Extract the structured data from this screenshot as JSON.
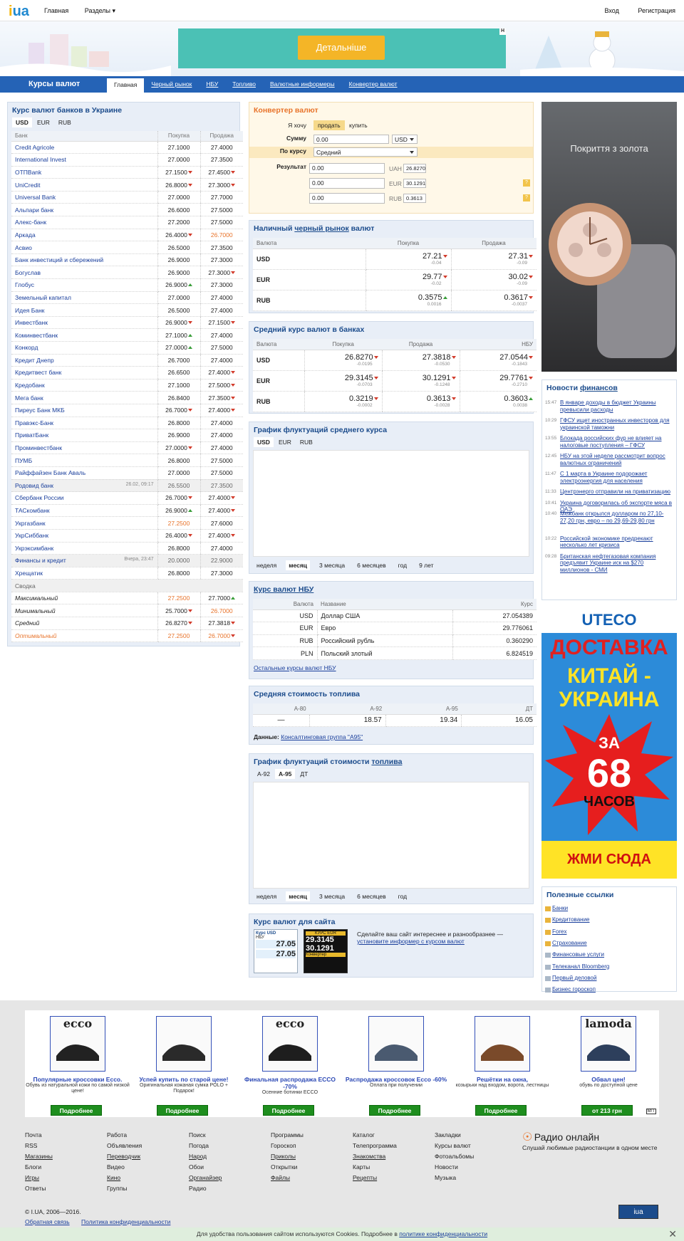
{
  "topbar": {
    "logo_i": "i",
    "logo_ua": "ua",
    "home": "Главная",
    "sections": "Разделы ▾",
    "login": "Вход",
    "register": "Регистрация"
  },
  "banner": {
    "ad_button": "Детальніше",
    "ad_mark": "Н"
  },
  "nav": {
    "title": "Курсы валют",
    "tabs": [
      "Главная",
      "Черный рынок",
      "НБУ",
      "Топливо",
      "Валютные информеры",
      "Конвертер валют"
    ]
  },
  "banks": {
    "title": "Курс валют банков в Украине",
    "currencies": [
      "USD",
      "EUR",
      "RUB"
    ],
    "headers": [
      "Банк",
      "Покупка",
      "Продажа"
    ],
    "rows": [
      {
        "name": "Credit Agricole",
        "buy": "27.1000",
        "sell": "27.4000"
      },
      {
        "name": "International Invest",
        "buy": "27.0000",
        "sell": "27.3500"
      },
      {
        "name": "ОТПBank",
        "buy": "27.1500",
        "sell": "27.4500",
        "bt": "dn",
        "st": "dn"
      },
      {
        "name": "UniCredit",
        "buy": "26.8000",
        "sell": "27.3000",
        "bt": "dn",
        "st": "dn"
      },
      {
        "name": "Universal Bank",
        "buy": "27.0000",
        "sell": "27.7000"
      },
      {
        "name": "Альпари банк",
        "buy": "26.6000",
        "sell": "27.5000"
      },
      {
        "name": "Алекс-банк",
        "buy": "27.2000",
        "sell": "27.5000"
      },
      {
        "name": "Аркада",
        "buy": "26.4000",
        "sell": "26.7000",
        "bt": "dn",
        "so": true
      },
      {
        "name": "Асвио",
        "buy": "26.5000",
        "sell": "27.3500"
      },
      {
        "name": "Банк инвестиций и сбережений",
        "buy": "26.9000",
        "sell": "27.3000"
      },
      {
        "name": "Богуслав",
        "buy": "26.9000",
        "sell": "27.3000",
        "st": "dn"
      },
      {
        "name": "Глобус",
        "buy": "26.9000",
        "sell": "27.3000",
        "bt": "up"
      },
      {
        "name": "Земельный капитал",
        "buy": "27.0000",
        "sell": "27.4000"
      },
      {
        "name": "Идея Банк",
        "buy": "26.5000",
        "sell": "27.4000"
      },
      {
        "name": "Инвестбанк",
        "buy": "26.9000",
        "sell": "27.1500",
        "bt": "dn",
        "st": "dn"
      },
      {
        "name": "Коминвестбанк",
        "buy": "27.1000",
        "sell": "27.4000",
        "bt": "up"
      },
      {
        "name": "Конкорд",
        "buy": "27.0000",
        "sell": "27.5000",
        "bt": "up"
      },
      {
        "name": "Кредит Днепр",
        "buy": "26.7000",
        "sell": "27.4000"
      },
      {
        "name": "Кредитвест банк",
        "buy": "26.6500",
        "sell": "27.4000",
        "st": "dn"
      },
      {
        "name": "Кредобанк",
        "buy": "27.1000",
        "sell": "27.5000",
        "st": "dn"
      },
      {
        "name": "Мега банк",
        "buy": "26.8400",
        "sell": "27.3500",
        "st": "dn"
      },
      {
        "name": "Пиреус Банк МКБ",
        "buy": "26.7000",
        "sell": "27.4000",
        "bt": "dn",
        "st": "dn"
      },
      {
        "name": "Правэкс-Банк",
        "buy": "26.8000",
        "sell": "27.4000"
      },
      {
        "name": "ПриватБанк",
        "buy": "26.9000",
        "sell": "27.4000"
      },
      {
        "name": "Проминвестбанк",
        "buy": "27.0000",
        "sell": "27.4000",
        "bt": "dn"
      },
      {
        "name": "ПУМБ",
        "buy": "26.8000",
        "sell": "27.5000"
      },
      {
        "name": "Райффайзен Банк Аваль",
        "buy": "27.0000",
        "sell": "27.5000"
      },
      {
        "name": "Родовид банк",
        "buy": "26.5500",
        "sell": "27.3500",
        "grey": true,
        "date": "26.02, 09:17"
      },
      {
        "name": "Сбербанк России",
        "buy": "26.7000",
        "sell": "27.4000",
        "bt": "dn",
        "st": "dn"
      },
      {
        "name": "ТАСкомбанк",
        "buy": "26.9000",
        "sell": "27.4000",
        "bt": "up",
        "st": "dn"
      },
      {
        "name": "Укргазбанк",
        "buy": "27.2500",
        "sell": "27.6000",
        "bo": true
      },
      {
        "name": "УкрСиббанк",
        "buy": "26.4000",
        "sell": "27.4000",
        "bt": "dn",
        "st": "dn"
      },
      {
        "name": "Укрэксимбанк",
        "buy": "26.8000",
        "sell": "27.4000"
      },
      {
        "name": "Финансы и кредит",
        "buy": "20.0000",
        "sell": "22.9000",
        "grey": true,
        "date": "Вчера, 23:47"
      },
      {
        "name": "Хрещатик",
        "buy": "26.8000",
        "sell": "27.3000"
      }
    ],
    "summary_label": "Сводка",
    "summary": [
      {
        "name": "Максимальный",
        "buy": "27.2500",
        "sell": "27.7000",
        "bo": true,
        "st": "up"
      },
      {
        "name": "Минимальный",
        "buy": "25.7000",
        "sell": "26.7000",
        "bt": "dn",
        "so": true
      },
      {
        "name": "Средний",
        "buy": "26.8270",
        "sell": "27.3818",
        "bt": "dn",
        "st": "dn"
      },
      {
        "name": "Оптимальный",
        "buy": "27.2500",
        "sell": "26.7000",
        "bo": true,
        "so": true,
        "st": "dn",
        "name_org": true
      }
    ]
  },
  "converter": {
    "title": "Конвертер валют",
    "want": "Я хочу",
    "sell": "продать",
    "buy": "купить",
    "sum": "Сумму",
    "sum_value": "0.00",
    "currency": "USD",
    "rate": "По курсу",
    "rate_value": "Средний",
    "result": "Результат",
    "results": [
      {
        "value": "0.00",
        "cur": "UAH",
        "rate": "26.8270"
      },
      {
        "value": "0.00",
        "cur": "EUR",
        "rate": "30.1291"
      },
      {
        "value": "0.00",
        "cur": "RUB",
        "rate": "0.3613"
      }
    ],
    "help": "?"
  },
  "black": {
    "title_a": "Наличный ",
    "title_b": "черный рынок",
    "title_c": " валют",
    "headers": [
      "Валюта",
      "Покупка",
      "Продажа"
    ],
    "rows": [
      {
        "cur": "USD",
        "buy": "27.21",
        "bd": "-0.04",
        "bt": "dn",
        "sell": "27.31",
        "sd": "-0.09",
        "st": "dn"
      },
      {
        "cur": "EUR",
        "buy": "29.77",
        "bd": "-0.02",
        "bt": "dn",
        "sell": "30.02",
        "sd": "-0.09",
        "st": "dn"
      },
      {
        "cur": "RUB",
        "buy": "0.3575",
        "bd": "0.0016",
        "bt": "up",
        "sell": "0.3617",
        "sd": "-0.0037",
        "st": "dn"
      }
    ]
  },
  "avg": {
    "title": "Средний курс валют в банках",
    "headers": [
      "Валюта",
      "Покупка",
      "Продажа",
      "НБУ"
    ],
    "rows": [
      {
        "cur": "USD",
        "buy": "26.8270",
        "bd": "-0.0195",
        "sell": "27.3818",
        "sd": "-0.0530",
        "nbu": "27.0544",
        "nd": "-0.1843",
        "bt": "dn",
        "st": "dn",
        "nt": "dn"
      },
      {
        "cur": "EUR",
        "buy": "29.3145",
        "bd": "-0.0703",
        "sell": "30.1291",
        "sd": "-0.1248",
        "nbu": "29.7761",
        "nd": "-0.2710",
        "bt": "dn",
        "st": "dn",
        "nt": "dn"
      },
      {
        "cur": "RUB",
        "buy": "0.3219",
        "bd": "-0.0002",
        "sell": "0.3613",
        "sd": "-0.0028",
        "nbu": "0.3603",
        "nd": "0.0038",
        "bt": "dn",
        "st": "dn",
        "nt": "up"
      }
    ]
  },
  "fluct": {
    "title": "График флуктуаций среднего курса",
    "currencies": [
      "USD",
      "EUR",
      "RUB"
    ],
    "periods": [
      "неделя",
      "месяц",
      "3 месяца",
      "6 месяцев",
      "год",
      "9 лет"
    ]
  },
  "nbu": {
    "title": "Курс валют НБУ",
    "headers": [
      "Валюта",
      "Название",
      "Курс"
    ],
    "rows": [
      {
        "cur": "USD",
        "name": "Доллар США",
        "rate": "27.054389"
      },
      {
        "cur": "EUR",
        "name": "Евро",
        "rate": "29.776061"
      },
      {
        "cur": "RUB",
        "name": "Российский рубль",
        "rate": "0.360290"
      },
      {
        "cur": "PLN",
        "name": "Польский злотый",
        "rate": "6.824519"
      }
    ],
    "other": "Остальные курсы валют НБУ"
  },
  "fuel": {
    "title": "Средняя стоимость топлива",
    "headers": [
      "А-80",
      "А-92",
      "А-95",
      "ДТ"
    ],
    "values": [
      "—",
      "18.57",
      "19.34",
      "16.05"
    ],
    "data_label": "Данные:",
    "data_src": "Консалтинговая группа \"А95\""
  },
  "fuelchart": {
    "title_a": "График флуктуаций стоимости ",
    "title_b": "топлива",
    "types": [
      "А-92",
      "А-95",
      "ДТ"
    ],
    "periods": [
      "неделя",
      "месяц",
      "3 месяца",
      "6 месяцев",
      "год"
    ]
  },
  "site": {
    "title": "Курс валют для сайта",
    "text": "Сделайте ваш сайт интереснее и разнообразнее — ",
    "link": "установите информер с курсом валют",
    "info1": [
      "Курс USD",
      "НБУ",
      "27.05",
      "27.05"
    ],
    "info2": [
      "КУРС EUR",
      "29.3145",
      "30.1291",
      "Конвертер"
    ]
  },
  "sidead": {
    "text": "Покриття з золота"
  },
  "news": {
    "title_a": "Новости ",
    "title_b": "финансов",
    "items": [
      {
        "t": "15:47",
        "x": "В январе доходы в бюджет Украины превысили расходы"
      },
      {
        "t": "10:29",
        "x": "ГФСУ ищет иностранных инвесторов для украинской таможни"
      },
      {
        "t": "13:55",
        "x": "Блокада российских фур не влияет на налоговые поступления – ГФСУ"
      },
      {
        "t": "12:45",
        "x": "НБУ на этой неделе рассмотрит вопрос валютных ограничений"
      },
      {
        "t": "11:47",
        "x": "С 1 марта в Украине подорожает электроэнергия для населения"
      },
      {
        "t": "11:33",
        "x": "Центрэнерго отправили на приватизацию"
      },
      {
        "t": "10:41",
        "x": "Украина договорилась об экспорте мяса в ОАЭ"
      },
      {
        "t": "10:40",
        "x": "Межбанк открылся долларом по 27,10-27,20 грн, евро – по 29,69-29,80 грн"
      },
      {
        "t": "10:22",
        "x": "Российской экономике предрекают несколько лет кризиса"
      },
      {
        "t": "09:28",
        "x": "Британская нефтегазовая компания предъявит Украине иск на $270 миллионов - СМИ"
      }
    ]
  },
  "ad2": {
    "brand": "UTECO",
    "line1": "ДОСТАВКА",
    "line2": "КИТАЙ -",
    "line3": "УКРАИНА",
    "line4": "ЗА",
    "num": "68",
    "line5": "ЧАСОВ",
    "cta": "ЖМИ СЮДА"
  },
  "useful": {
    "title": "Полезные ссылки",
    "items": [
      "Банки",
      "Кредитование",
      "Forex",
      "Страхование",
      "Финансовые услуги",
      "Телеканал Bloomberg",
      "Первый деловой",
      "Бизнес гороскоп"
    ]
  },
  "shop": {
    "items": [
      {
        "brand": "ecco",
        "t": "Популярные кроссовки Ecco.",
        "s": "Обувь из натуральной кожи по самой низкой цене!",
        "btn": "Подробнее"
      },
      {
        "brand": "",
        "t": "Успей купить по старой цене!",
        "s": "Оригинальная кожаная сумка POLO + Подарок!",
        "btn": "Подробнее"
      },
      {
        "brand": "ecco",
        "t": "Финальная распродажа ECCO -70%",
        "s": "Осенние ботинки ECCO",
        "btn": "Подробнее"
      },
      {
        "brand": "",
        "t": "Распродажа кроссовок Ecco -60%",
        "s": "Оплата при получении",
        "btn": "Подробнее"
      },
      {
        "brand": "",
        "t": "Решётки на окна,",
        "s": "козырьки над входом, ворота, лестницы",
        "btn": "Подробнее"
      },
      {
        "brand": "lamoda",
        "t": "Обвал цен!",
        "s": "обувь по доступной цене",
        "btn": "от 213 грн"
      }
    ],
    "mark": "M/T"
  },
  "footer": {
    "cols": [
      [
        "Почта",
        "RSS",
        "Магазины",
        "Блоги",
        "Игры",
        "Ответы"
      ],
      [
        "Работа",
        "Объявления",
        "Переводчик",
        "Видео",
        "Кино",
        "Группы"
      ],
      [
        "Поиск",
        "Погода",
        "Народ",
        "Обои",
        "Органайзер",
        "Радио"
      ],
      [
        "Программы",
        "Гороскоп",
        "Приколы",
        "Открытки",
        "Файлы"
      ],
      [
        "Каталог",
        "Телепрограмма",
        "Знакомства",
        "Карты",
        "Рецепты"
      ],
      [
        "Закладки",
        "Курсы валют",
        "Фотоальбомы",
        "Новости",
        "Музыка"
      ]
    ],
    "radio_title": "Радио онлайн",
    "radio_text": "Слушай любимые радиостанции в одном месте",
    "copy": "© I.UA, 2006—2016.",
    "feedback": "Обратная связь",
    "privacy": "Политика конфиденциальности",
    "counter": "iua"
  },
  "cookie": {
    "text": "Для удобства пользования сайтом используются Cookies. Подробнее в ",
    "link": "политике конфиденциальности"
  }
}
